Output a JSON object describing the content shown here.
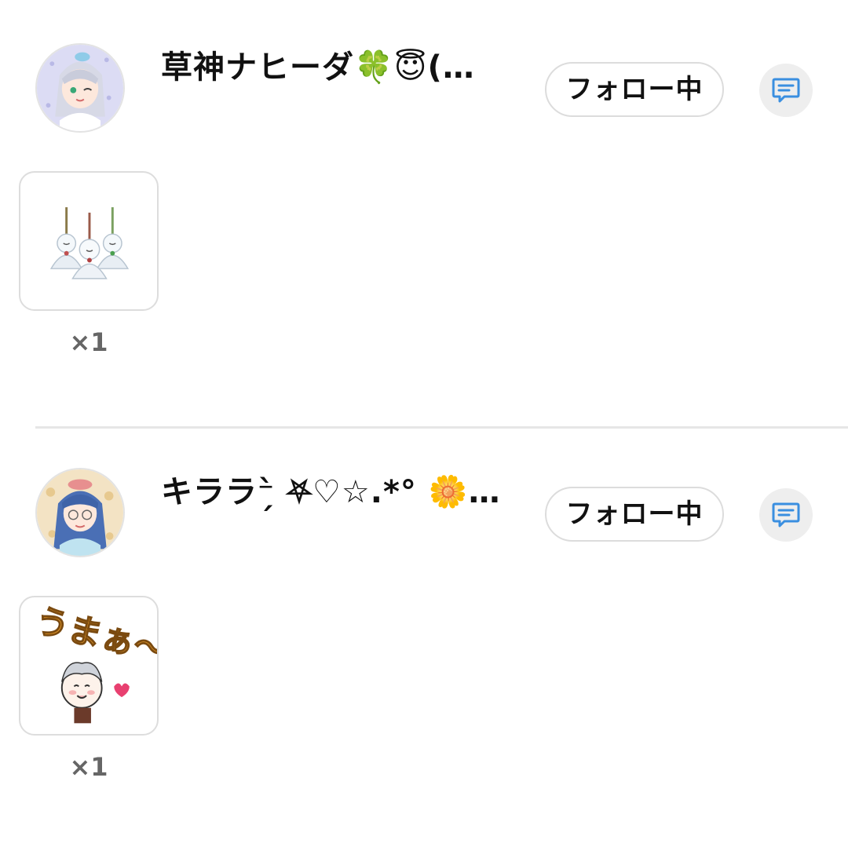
{
  "follows": [
    {
      "username": "草神ナヒーダ🍀😇(…",
      "follow_label": "フォロー中",
      "gift_count": "×1",
      "avatar_icon": "anime-girl-avatar",
      "gift_icon": "teru-teru-bozu-sticker"
    },
    {
      "username": "キララ⁻̗̀ ⛧♡☆.*° 🌼…",
      "follow_label": "フォロー中",
      "gift_count": "×1",
      "avatar_icon": "anime-girl-with-glasses-avatar",
      "gift_icon": "umaa-sticker",
      "sticker_text": "うまぁ〜"
    }
  ],
  "colors": {
    "message_icon": "#3a8fe0",
    "button_border": "#dcdcdc",
    "divider": "#e6e6e6",
    "count_text": "#666666"
  }
}
